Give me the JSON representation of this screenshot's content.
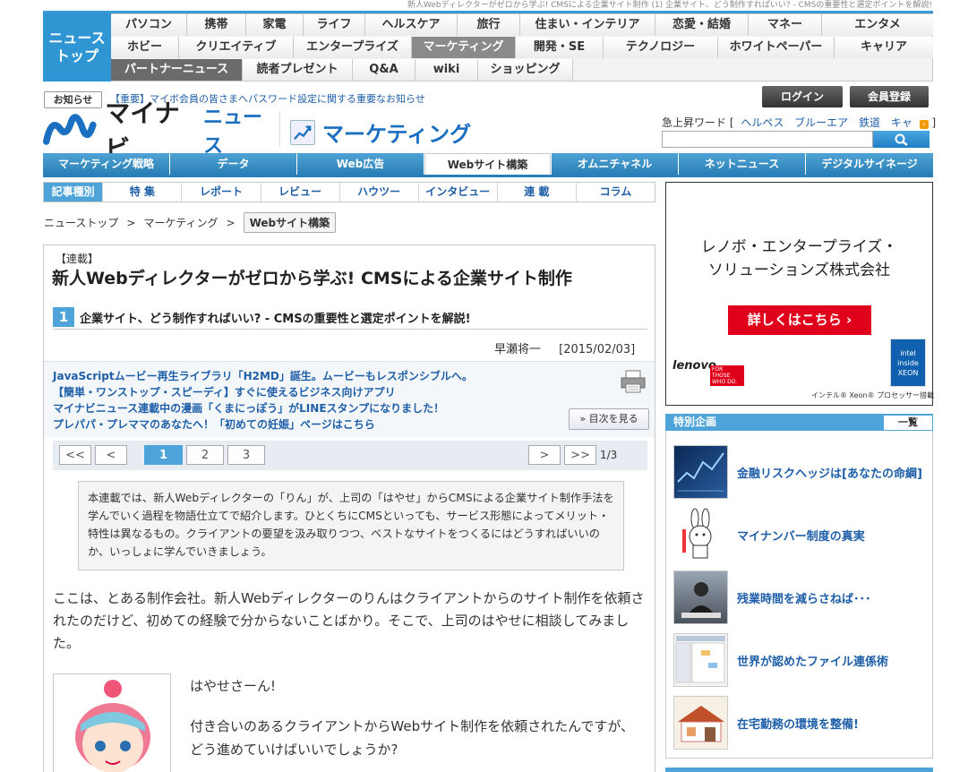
{
  "top_breadcrumb": "新人Webディレクターがゼロから学ぶ! CMSによる企業サイト制作 (1) 企業サイト、どう制作すればいい? - CMSの重要性と選定ポイントを解説!",
  "nav": {
    "home_line1": "ニュース",
    "home_line2": "トップ",
    "row1": [
      "パソコン",
      "携帯",
      "家電",
      "ライフ",
      "ヘルスケア",
      "旅行",
      "住まい・インテリア",
      "恋愛・結婚",
      "マネー",
      "エンタメ"
    ],
    "row2": [
      "ホビー",
      "クリエイティブ",
      "エンタープライズ",
      "マーケティング",
      "開発・SE",
      "テクノロジー",
      "ホワイトペーパー",
      "キャリア"
    ],
    "row3": [
      "パートナーニュース",
      "読者プレゼント",
      "Q&A",
      "wiki",
      "ショッピング"
    ]
  },
  "notice": {
    "label": "お知らせ",
    "text": "【重要】マイボ会員の皆さまへパスワード設定に関する重要なお知らせ"
  },
  "account": {
    "login": "ログイン",
    "register": "会員登録"
  },
  "logo": {
    "brand": "マイナビ",
    "news": "ニュース",
    "section": "マーケティング"
  },
  "trend": {
    "label": "急上昇ワード",
    "words": [
      "ヘルペス",
      "ブルーエア",
      "鉄道",
      "キャ"
    ]
  },
  "search": {
    "placeholder": "",
    "icon": "search-icon"
  },
  "category_tabs": [
    "マーケティング戦略",
    "データ",
    "Web広告",
    "Webサイト構築",
    "オムニチャネル",
    "ネットニュース",
    "デジタルサイネージ"
  ],
  "article_types": {
    "label": "記事種別",
    "items": [
      "特 集",
      "レポート",
      "レビュー",
      "ハウツー",
      "インタビュー",
      "連 載",
      "コラム"
    ]
  },
  "breadcrumb": [
    "ニューストップ",
    "マーケティング",
    "Webサイト構築"
  ],
  "article": {
    "series_tag": "【連載】",
    "title": "新人Webディレクターがゼロから学ぶ! CMSによる企業サイト制作",
    "part_number": "1",
    "part_title": "企業サイト、どう制作すればいい? - CMSの重要性と選定ポイントを解説!",
    "author": "早瀬将一",
    "date": "[2015/02/03]",
    "related": [
      "JavaScriptムービー再生ライブラリ「H2MD」誕生。ムービーもレスポンシブルへ。",
      "【簡単・ワンストップ・スピーディ】すぐに使えるビジネス向けアプリ",
      "マイナビニュース連載中の漫画「くまにっぽう」がLINEスタンプになりました！",
      "プレパパ・プレママのあなたへ！「初めての妊娠」ページはこちら"
    ],
    "toc_button": "» 目次を見る",
    "pager": {
      "first": "<<",
      "prev": "<",
      "pages": [
        "1",
        "2",
        "3"
      ],
      "next": ">",
      "last": ">>",
      "count": "1/3"
    },
    "lead": "本連載では、新人Webディレクターの「りん」が、上司の「はやせ」からCMSによる企業サイト制作手法を学んでいく過程を物語仕立てで紹介します。ひとくちにCMSといっても、サービス形態によってメリット・特性は異なるもの。クライアントの要望を汲み取りつつ、ベストなサイトをつくるにはどうすればいいのか、いっしょに学んでいきましょう。",
    "body": "ここは、とある制作会社。新人Webディレクターのりんはクライアントからのサイト制作を依頼されたのだけど、初めての経験で分からないことばかり。そこで、上司のはやせに相談してみました。",
    "speech1": "はやせさーん!",
    "speech2": "付き合いのあるクライアントからWebサイト制作を依頼されたんですが、どう進めていけばいいでしょうか?"
  },
  "ad": {
    "title_line1": "レノボ・エンタープライズ・",
    "title_line2": "ソリューションズ株式会社",
    "button": "詳しくはこちら",
    "lenovo": "lenovo",
    "lenovo_tag": "FOR THOSE WHO DO.",
    "intel": "intel inside XEON",
    "note": "インテル® Xeon® プロセッサー搭載"
  },
  "special": {
    "title": "特別企画",
    "all": "一覧",
    "items": [
      {
        "text": "金融リスクヘッジは[あなたの命綱]",
        "thumb": "chart-thumb"
      },
      {
        "text": "マイナンバー制度の真実",
        "thumb": "rabbit-thumb"
      },
      {
        "text": "残業時間を減らさねば･･･",
        "thumb": "worker-thumb"
      },
      {
        "text": "世界が認めたファイル連係術",
        "thumb": "screenshot-thumb"
      },
      {
        "text": "在宅勤務の環境を整備!",
        "thumb": "house-thumb"
      }
    ]
  }
}
